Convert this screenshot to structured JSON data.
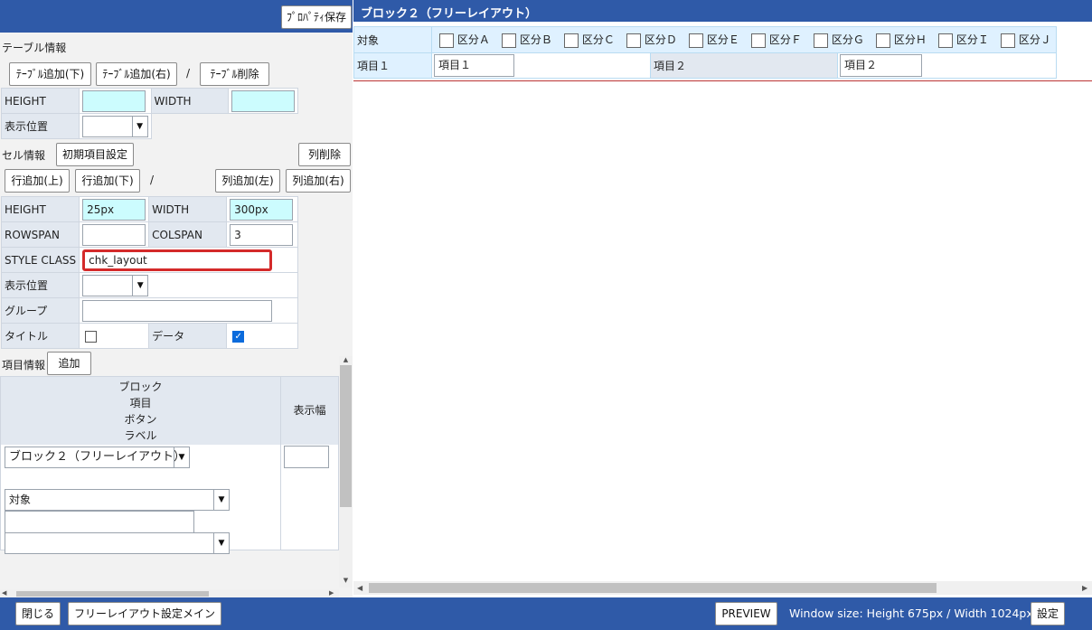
{
  "left": {
    "property_save": "ﾌﾟﾛﾊﾟﾃｨ保存",
    "table_section": {
      "title": "テーブル情報",
      "add_down": "ﾃｰﾌﾞﾙ追加(下)",
      "add_right": "ﾃｰﾌﾞﾙ追加(右)",
      "slash": "/",
      "delete": "ﾃｰﾌﾞﾙ削除",
      "height_label": "HEIGHT",
      "height_value": "",
      "width_label": "WIDTH",
      "width_value": "",
      "position_label": "表示位置",
      "position_value": ""
    },
    "cell_section": {
      "title": "セル情報",
      "init_items": "初期項目設定",
      "col_delete": "列削除",
      "row_add_up": "行追加(上)",
      "row_add_down": "行追加(下)",
      "slash": "/",
      "col_add_left": "列追加(左)",
      "col_add_right": "列追加(右)",
      "height_label": "HEIGHT",
      "height_value": "25px",
      "width_label": "WIDTH",
      "width_value": "300px",
      "rowspan_label": "ROWSPAN",
      "rowspan_value": "",
      "colspan_label": "COLSPAN",
      "colspan_value": "3",
      "style_class_label": "STYLE CLASS",
      "style_class_value": "chk_layout",
      "position_label": "表示位置",
      "position_value": "",
      "group_label": "グループ",
      "group_value": "",
      "title_label": "タイトル",
      "title_checked": false,
      "data_label": "データ",
      "data_checked": true
    },
    "item_section": {
      "title": "項目情報",
      "add": "追加",
      "header_lines": [
        "ブロック",
        "項目",
        "ボタン",
        "ラベル"
      ],
      "width_header": "表示幅",
      "block_select": "ブロック２（フリーレイアウト）",
      "item_select": "対象",
      "button_select": "",
      "label_value": "",
      "width_value": ""
    }
  },
  "right": {
    "header_title": "ブロック２（フリーレイアウト）",
    "row1_label": "対象",
    "checkboxes": [
      "区分Ａ",
      "区分Ｂ",
      "区分Ｃ",
      "区分Ｄ",
      "区分Ｅ",
      "区分Ｆ",
      "区分Ｇ",
      "区分Ｈ",
      "区分Ｉ",
      "区分Ｊ"
    ],
    "row2_label": "項目１",
    "row2_input1": "項目１",
    "row2_label2": "項目２",
    "row2_input2": "項目２"
  },
  "footer": {
    "close": "閉じる",
    "main": "フリーレイアウト設定メイン",
    "preview": "PREVIEW",
    "window_size": "Window size: Height 675px / Width 1024px",
    "settings": "設定"
  },
  "colors": {
    "blue_bar": "#2f5aa8",
    "label_cell": "#e2e8f0",
    "cyan_input": "#ccfcfe",
    "highlight_border": "#d42a2a",
    "preview_cell": "#dff1ff"
  }
}
